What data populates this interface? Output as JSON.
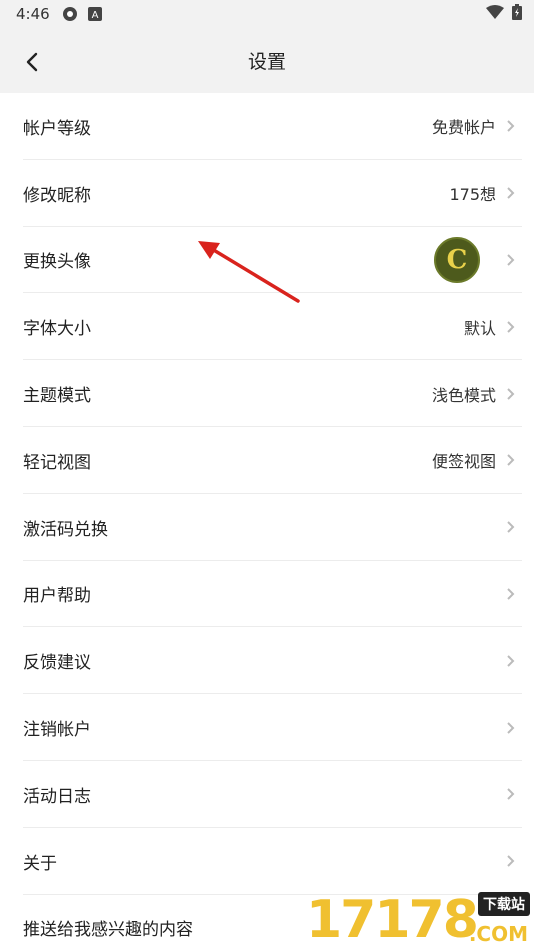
{
  "status": {
    "time": "4:46"
  },
  "header": {
    "title": "设置"
  },
  "rows": [
    {
      "label": "帐户等级",
      "value": "免费帐户"
    },
    {
      "label": "修改昵称",
      "value": "175想"
    },
    {
      "label": "更换头像",
      "value": ""
    },
    {
      "label": "字体大小",
      "value": "默认"
    },
    {
      "label": "主题模式",
      "value": "浅色模式"
    },
    {
      "label": "轻记视图",
      "value": "便签视图"
    },
    {
      "label": "激活码兑换",
      "value": ""
    },
    {
      "label": "用户帮助",
      "value": ""
    },
    {
      "label": "反馈建议",
      "value": ""
    },
    {
      "label": "注销帐户",
      "value": ""
    },
    {
      "label": "活动日志",
      "value": ""
    },
    {
      "label": "关于",
      "value": ""
    },
    {
      "label": "推送给我感兴趣的内容",
      "value": ""
    }
  ],
  "avatar": {
    "letter": "C"
  },
  "watermark": {
    "number": "17178",
    "tag": "下载站",
    "suffix": ".COM"
  },
  "colors": {
    "annotation_arrow": "#d9231d",
    "watermark": "#f0c030"
  }
}
